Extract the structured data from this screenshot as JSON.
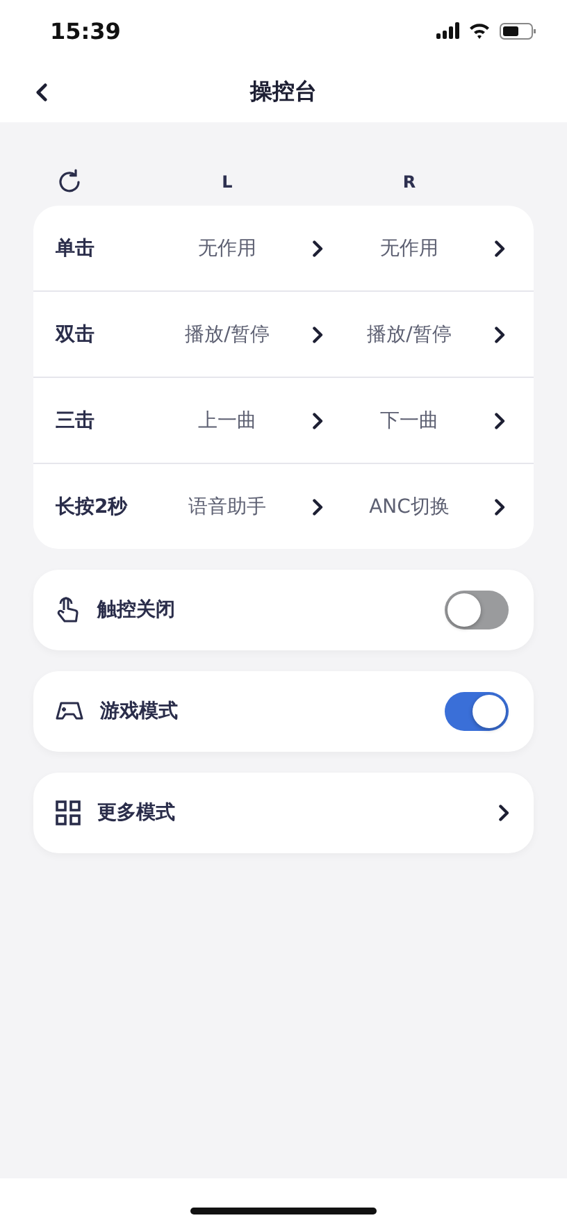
{
  "status_bar": {
    "time": "15:39"
  },
  "header": {
    "title": "操控台"
  },
  "gesture_table": {
    "columns": [
      "L",
      "R"
    ],
    "rows": [
      {
        "gesture": "单击",
        "left": "无作用",
        "right": "无作用"
      },
      {
        "gesture": "双击",
        "left": "播放/暂停",
        "right": "播放/暂停"
      },
      {
        "gesture": "三击",
        "left": "上一曲",
        "right": "下一曲"
      },
      {
        "gesture": "长按2秒",
        "left": "语音助手",
        "right": "ANC切换"
      }
    ]
  },
  "settings": [
    {
      "kind": "toggle",
      "label": "触控关闭",
      "on": false
    },
    {
      "kind": "toggle",
      "label": "游戏模式",
      "on": true
    },
    {
      "kind": "link",
      "label": "更多模式"
    }
  ]
}
